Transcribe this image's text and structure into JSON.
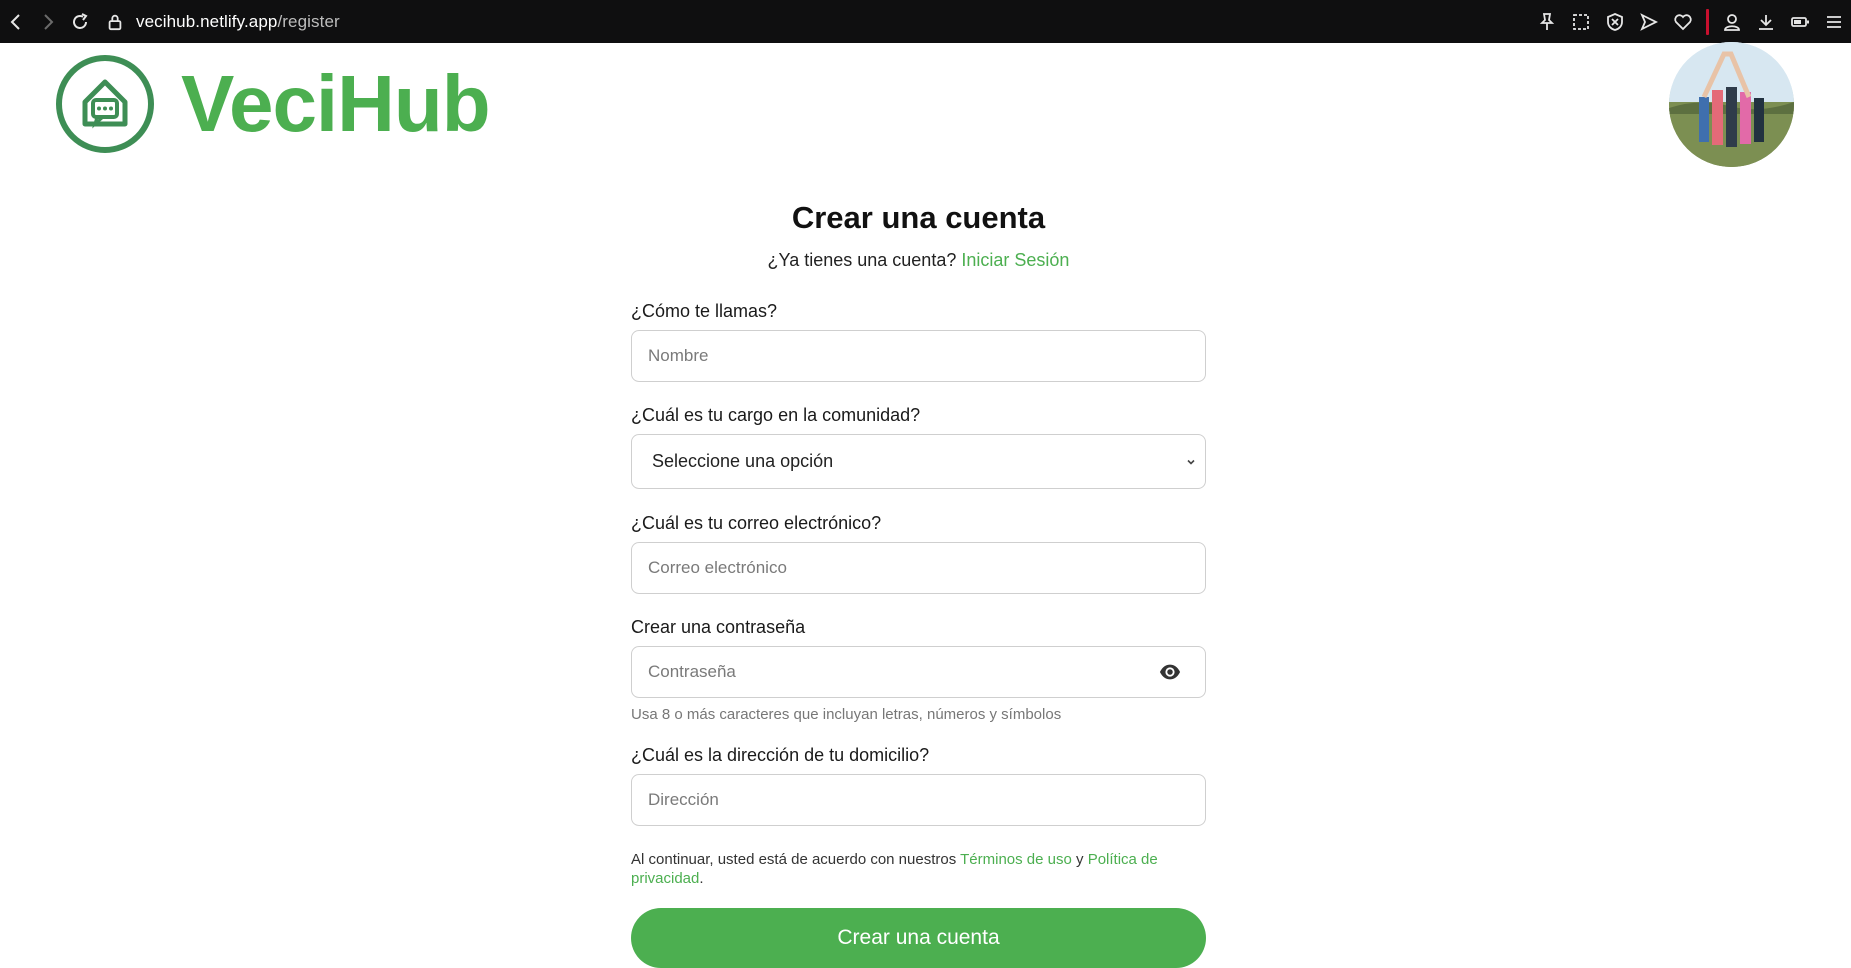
{
  "browser": {
    "url_host": "vecihub.netlify.app",
    "url_path": "/register",
    "icons": [
      "back-icon",
      "forward-icon",
      "reload-icon",
      "lock-icon",
      "pin-icon",
      "screenshot-icon",
      "shield-icon",
      "send-icon",
      "heart-icon",
      "profile-icon",
      "download-icon",
      "battery-icon",
      "menu-icon"
    ]
  },
  "brand": {
    "name": "VeciHub",
    "accent_color": "#4caf50",
    "logo_color": "#3e8e55"
  },
  "form": {
    "title": "Crear una cuenta",
    "have_account_text": "¿Ya tienes una cuenta?",
    "login_link": "Iniciar Sesión",
    "name": {
      "label": "¿Cómo te llamas?",
      "placeholder": "Nombre"
    },
    "role": {
      "label": "¿Cuál es tu cargo en la comunidad?",
      "selected": "Seleccione una opción"
    },
    "email": {
      "label": "¿Cuál es tu correo electrónico?",
      "placeholder": "Correo electrónico"
    },
    "password": {
      "label": "Crear una contraseña",
      "placeholder": "Contraseña",
      "hint": "Usa 8 o más caracteres que incluyan letras, números y símbolos"
    },
    "address": {
      "label": "¿Cuál es la dirección de tu domicilio?",
      "placeholder": "Dirección"
    },
    "terms_prefix": "Al continuar, usted está de acuerdo con nuestros",
    "terms_link": "Términos de uso",
    "terms_and": "y",
    "privacy_link": "Política de privacidad",
    "terms_suffix": ".",
    "submit_label": "Crear una cuenta"
  }
}
